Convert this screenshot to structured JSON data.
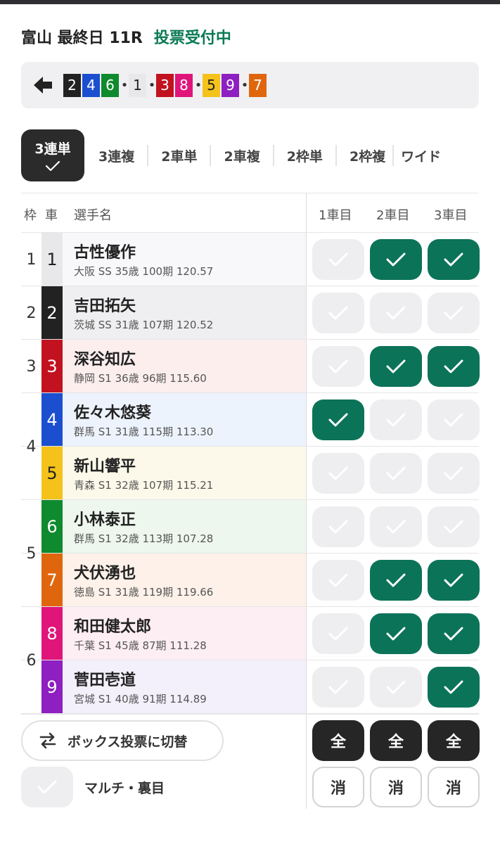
{
  "header": {
    "title": "富山 最終日 11R",
    "status": "投票受付中",
    "status_color": "#0b7a55"
  },
  "order": {
    "back_icon": "arrow-left-icon",
    "chips": [
      {
        "label": "2",
        "bg": "#222222",
        "fg": "#ffffff"
      },
      {
        "label": "4",
        "bg": "#1c4fd0",
        "fg": "#ffffff"
      },
      {
        "label": "6",
        "bg": "#0f8a2e",
        "fg": "#ffffff"
      },
      {
        "label": "•",
        "dot": true
      },
      {
        "label": "1",
        "bg": "#e8e8ea",
        "fg": "#222222"
      },
      {
        "label": "•",
        "dot": true
      },
      {
        "label": "3",
        "bg": "#c2121f",
        "fg": "#ffffff"
      },
      {
        "label": "8",
        "bg": "#e0157a",
        "fg": "#ffffff"
      },
      {
        "label": "•",
        "dot": true
      },
      {
        "label": "5",
        "bg": "#f4c21b",
        "fg": "#222222"
      },
      {
        "label": "9",
        "bg": "#8e1fc0",
        "fg": "#ffffff"
      },
      {
        "label": "•",
        "dot": true
      },
      {
        "label": "7",
        "bg": "#e0660e",
        "fg": "#ffffff"
      }
    ]
  },
  "tabs": {
    "active": "3連単",
    "items": [
      "3連複",
      "2車単",
      "2車複",
      "2枠単",
      "2枠複",
      "ワイド"
    ]
  },
  "table": {
    "headers": {
      "waku": "枠",
      "car": "車",
      "name": "選手名",
      "pos1": "1車目",
      "pos2": "2車目",
      "pos3": "3車目"
    },
    "waku_groups": [
      "1",
      "2",
      "3",
      "4",
      "5",
      "6"
    ],
    "rows": [
      {
        "car": "1",
        "name": "古性優作",
        "info": "大阪 SS 35歳 100期 120.57",
        "car_bg": "#e8e8ea",
        "car_fg": "#222222",
        "row_bg": "#f8f8fa",
        "checks": [
          false,
          true,
          true
        ]
      },
      {
        "car": "2",
        "name": "吉田拓矢",
        "info": "茨城 SS 31歳 107期 120.52",
        "car_bg": "#222222",
        "car_fg": "#ffffff",
        "row_bg": "#efeff1",
        "checks": [
          false,
          false,
          false
        ]
      },
      {
        "car": "3",
        "name": "深谷知広",
        "info": "静岡 S1 36歳 96期 115.60",
        "car_bg": "#c2121f",
        "car_fg": "#ffffff",
        "row_bg": "#fdeeee",
        "checks": [
          false,
          true,
          true
        ]
      },
      {
        "car": "4",
        "name": "佐々木悠葵",
        "info": "群馬 S1 31歳 115期 113.30",
        "car_bg": "#1c4fd0",
        "car_fg": "#ffffff",
        "row_bg": "#edf3fc",
        "checks": [
          true,
          false,
          false
        ]
      },
      {
        "car": "5",
        "name": "新山響平",
        "info": "青森 S1 32歳 107期 115.21",
        "car_bg": "#f4c21b",
        "car_fg": "#222222",
        "row_bg": "#fdf9ea",
        "checks": [
          false,
          false,
          false
        ]
      },
      {
        "car": "6",
        "name": "小林泰正",
        "info": "群馬 S1 32歳 113期 107.28",
        "car_bg": "#0f8a2e",
        "car_fg": "#ffffff",
        "row_bg": "#edf7ee",
        "checks": [
          false,
          false,
          false
        ]
      },
      {
        "car": "7",
        "name": "犬伏湧也",
        "info": "徳島 S1 31歳 119期 119.66",
        "car_bg": "#e0660e",
        "car_fg": "#ffffff",
        "row_bg": "#fdf1e9",
        "checks": [
          false,
          true,
          true
        ]
      },
      {
        "car": "8",
        "name": "和田健太郎",
        "info": "千葉 S1 45歳 87期 111.28",
        "car_bg": "#e0157a",
        "car_fg": "#ffffff",
        "row_bg": "#fdeef3",
        "checks": [
          false,
          true,
          true
        ]
      },
      {
        "car": "9",
        "name": "菅田壱道",
        "info": "宮城 S1 40歳 91期 114.89",
        "car_bg": "#8e1fc0",
        "car_fg": "#ffffff",
        "row_bg": "#f3f0fb",
        "checks": [
          false,
          false,
          true
        ]
      }
    ]
  },
  "footer": {
    "box_label": "ボックス投票に切替",
    "box_icon": "swap-arrows-icon",
    "multi_label": "マルチ・裏目",
    "all_label": "全",
    "clear_label": "消"
  },
  "colors": {
    "check_on": "#0b7358",
    "check_off": "#eeeef0"
  }
}
